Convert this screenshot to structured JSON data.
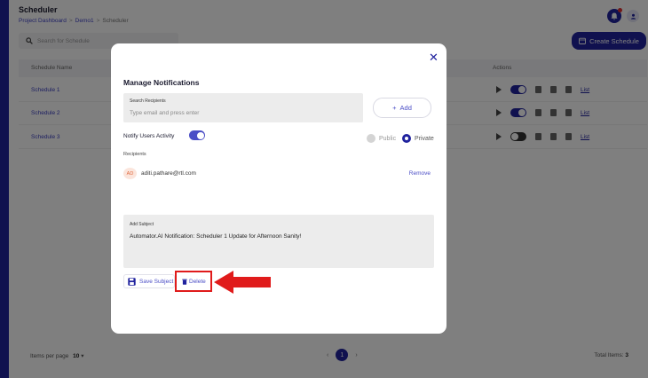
{
  "app": {
    "title": "Scheduler",
    "breadcrumb": [
      "Project Dashboard",
      "Demo1",
      "Scheduler"
    ],
    "breadcrumb_sep": ">",
    "search_placeholder": "Search for Schedule",
    "create_button": "Create Schedule",
    "table": {
      "headers": {
        "name": "Schedule Name",
        "actions": "Actions"
      },
      "rows": [
        {
          "name": "Schedule 1",
          "toggle_on": true,
          "link": "List"
        },
        {
          "name": "Schedule 2",
          "toggle_on": true,
          "link": "List"
        },
        {
          "name": "Schedule 3",
          "toggle_on": false,
          "link": "List"
        }
      ]
    },
    "footer": {
      "items_per_page_label": "Items per page",
      "items_per_page_value": "10",
      "current_page": "1",
      "total_label": "Total Items:",
      "total_value": "3"
    }
  },
  "modal": {
    "close_icon": "close-icon",
    "title": "Manage Notifications",
    "search_recipients_label": "Search Recipients",
    "search_recipients_placeholder": "Type email and press enter",
    "add_button": "Add",
    "notify_label": "Notify Users Activity",
    "notify_on": true,
    "visibility_options": [
      "Public",
      "Private"
    ],
    "visibility_selected": "Private",
    "recipients_heading": "Recipients",
    "recipients": [
      {
        "initials": "AD",
        "email": "aditi.pathare@rtl.com",
        "action": "Remove"
      }
    ],
    "subject_label": "Add Subject",
    "subject_text": "Automator.AI Notification: Scheduler 1 Update for Afternoon Sanity!",
    "save_button": "Save Subject",
    "delete_button": "Delete"
  },
  "annotation": {
    "highlight_color": "#e01b1b",
    "target": "Delete"
  },
  "colors": {
    "brand": "#20229e",
    "accent": "#4b4ec6",
    "annotation": "#e01b1b"
  }
}
